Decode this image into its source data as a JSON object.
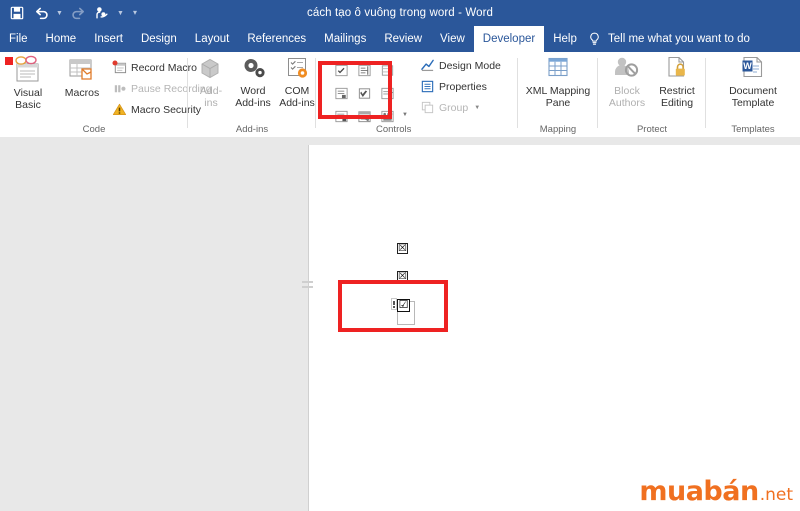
{
  "window": {
    "title": "cách tạo ô vuông trong word  -  Word"
  },
  "quick_access": {
    "items": [
      {
        "name": "save-icon",
        "label": "Save",
        "enabled": true
      },
      {
        "name": "undo-icon",
        "label": "Undo",
        "enabled": true
      },
      {
        "name": "redo-icon",
        "label": "Redo",
        "enabled": false
      },
      {
        "name": "touch-mouse-mode-icon",
        "label": "Touch/Mouse Mode",
        "enabled": true
      },
      {
        "name": "customize-quick-access-toolbar-icon",
        "label": "Customize Quick Access Toolbar",
        "enabled": true
      }
    ]
  },
  "ribbon": {
    "tabs": [
      {
        "label": "File",
        "active": false
      },
      {
        "label": "Home",
        "active": false
      },
      {
        "label": "Insert",
        "active": false
      },
      {
        "label": "Design",
        "active": false
      },
      {
        "label": "Layout",
        "active": false
      },
      {
        "label": "References",
        "active": false
      },
      {
        "label": "Mailings",
        "active": false
      },
      {
        "label": "Review",
        "active": false
      },
      {
        "label": "View",
        "active": false
      },
      {
        "label": "Developer",
        "active": true
      },
      {
        "label": "Help",
        "active": false
      }
    ],
    "tell_me": "Tell me what you want to do",
    "groups": {
      "code": {
        "label": "Code",
        "visual_basic": "Visual\nBasic",
        "visual_basic_line1": "Visual",
        "visual_basic_line2": "Basic",
        "macros": "Macros",
        "record_macro": "Record Macro",
        "pause_recording": "Pause Recording",
        "macro_security": "Macro Security"
      },
      "addins": {
        "label": "Add-ins",
        "addins_line1": "Add-",
        "addins_line2": "ins",
        "word_addins_line1": "Word",
        "word_addins_line2": "Add-ins",
        "com_addins_line1": "COM",
        "com_addins_line2": "Add-ins"
      },
      "controls": {
        "label": "Controls",
        "design_mode": "Design Mode",
        "properties": "Properties",
        "group": "Group",
        "gallery_items": [
          "rich-text-content-control-icon",
          "plain-text-content-control-icon",
          "picture-content-control-icon",
          "building-block-gallery-content-control-icon",
          "check-box-content-control-icon",
          "combo-box-content-control-icon",
          "drop-down-list-content-control-icon",
          "date-picker-content-control-icon",
          "repeating-section-content-control-icon",
          "legacy-tools-icon"
        ]
      },
      "mapping": {
        "label": "Mapping",
        "xml_mapping_pane_line1": "XML Mapping",
        "xml_mapping_pane_line2": "Pane"
      },
      "protect": {
        "label": "Protect",
        "block_authors_line1": "Block",
        "block_authors_line2": "Authors",
        "restrict_editing_line1": "Restrict",
        "restrict_editing_line2": "Editing"
      },
      "templates": {
        "label": "Templates",
        "document_template_line1": "Document",
        "document_template_line2": "Template"
      }
    }
  },
  "document": {
    "checkbox_line_1": "☒",
    "checkbox_line_2": "☒",
    "checkbox_line_3_checked": "☑"
  },
  "watermark": {
    "brand": "muabán",
    "suffix": ".net"
  },
  "colors": {
    "ribbon_blue": "#2b579a",
    "highlight_red": "#ee2222",
    "watermark_orange": "#f07020",
    "workarea_gray": "#e8e8e8"
  }
}
